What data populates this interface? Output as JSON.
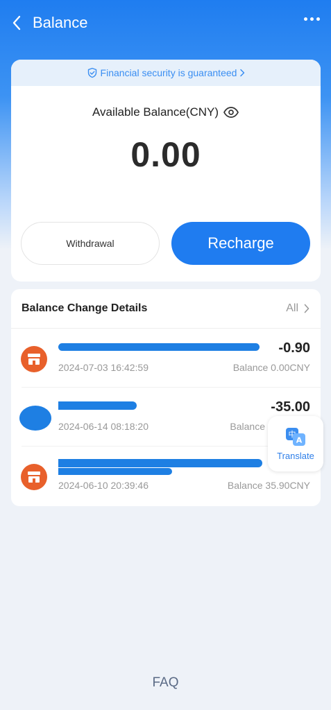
{
  "header": {
    "title": "Balance"
  },
  "balance_card": {
    "security_text": "Financial security is guaranteed",
    "available_label": "Available Balance(CNY)",
    "amount": "0.00",
    "withdraw_label": "Withdrawal",
    "recharge_label": "Recharge"
  },
  "details": {
    "title": "Balance Change Details",
    "all_label": "All",
    "rows": [
      {
        "amount": "-0.90",
        "date": "2024-07-03 16:42:59",
        "balance": "Balance 0.00CNY"
      },
      {
        "amount": "-35.00",
        "date": "2024-06-14 08:18:20",
        "balance": "Balance"
      },
      {
        "amount": "",
        "date": "2024-06-10 20:39:46",
        "balance": "Balance 35.90CNY"
      }
    ]
  },
  "translate": {
    "label": "Translate"
  },
  "footer": {
    "faq_label": "FAQ"
  },
  "colors": {
    "primary": "#1f7cf0",
    "merchant_icon": "#e8602b",
    "redaction": "#1e7fe3"
  },
  "icons": {
    "back": "chevron-left-icon",
    "more": "more-dots-icon",
    "security": "shield-check-icon",
    "visibility": "eye-icon",
    "merchant": "store-icon",
    "translate": "translate-icon"
  }
}
